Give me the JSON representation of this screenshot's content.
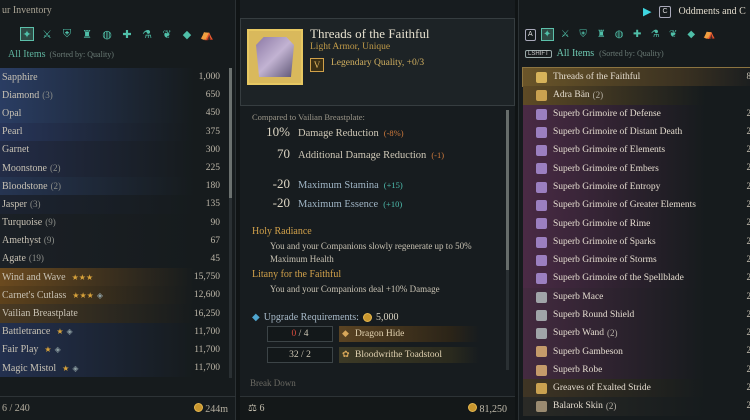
{
  "left": {
    "title": "ur Inventory",
    "all_items": "All Items",
    "sort": "(Sorted by: Quality)",
    "footer_count": "6 / 240",
    "footer_dist": "244m",
    "items": [
      {
        "name": "Sapphire",
        "count": "",
        "value": "1,000",
        "color": "#2a3d63"
      },
      {
        "name": "Diamond",
        "count": "(3)",
        "value": "650",
        "color": "#2a3d63"
      },
      {
        "name": "Opal",
        "count": "",
        "value": "450",
        "color": "#2a3d63"
      },
      {
        "name": "Pearl",
        "count": "",
        "value": "375",
        "color": "#27355a"
      },
      {
        "name": "Garnet",
        "count": "",
        "value": "300",
        "color": "#232c47"
      },
      {
        "name": "Moonstone",
        "count": "(2)",
        "value": "225",
        "color": "#232c47"
      },
      {
        "name": "Bloodstone",
        "count": "(2)",
        "value": "180",
        "color": "#263552"
      },
      {
        "name": "Jasper",
        "count": "(3)",
        "value": "135",
        "color": "#1c2331"
      },
      {
        "name": "Turquoise",
        "count": "(9)",
        "value": "90",
        "color": "#1b2026"
      },
      {
        "name": "Amethyst",
        "count": "(9)",
        "value": "67",
        "color": "#1b2026"
      },
      {
        "name": "Agate",
        "count": "(19)",
        "value": "45",
        "color": "#1b2026"
      },
      {
        "name": "Wind and Wave",
        "count": "",
        "stars": "★★★",
        "value": "15,750",
        "color": "#6b4a1f"
      },
      {
        "name": "Carnet's Cutlass",
        "count": "",
        "stars": "★★★",
        "mark": "◈",
        "value": "12,600",
        "color": "#5e421c"
      },
      {
        "name": "Vailian Breastplate",
        "count": "",
        "value": "16,250",
        "color": "#4a3a23"
      },
      {
        "name": "Battletrance",
        "count": "",
        "stars": "★",
        "mark": "◈",
        "value": "11,700",
        "color": "#23304f"
      },
      {
        "name": "Fair Play",
        "count": "",
        "stars": "★",
        "mark": "◈",
        "value": "11,700",
        "color": "#23304f"
      },
      {
        "name": "Magic Mistol",
        "count": "",
        "stars": "★",
        "mark": "◈",
        "value": "11,700",
        "color": "#23304f"
      }
    ]
  },
  "middle": {
    "item_name": "Threads of the Faithful",
    "item_type": "Light Armor, Unique",
    "level": "V",
    "quality": "Legendary Quality, +0/3",
    "compare": "Compared to Vailian Breastplate:",
    "stats": [
      {
        "value": "10%",
        "label": "Damage Reduction",
        "delta": "(-8%)",
        "kind": "neg"
      },
      {
        "value": "70",
        "label": "Additional Damage Reduction",
        "delta": "(-1)",
        "kind": "neg"
      },
      {
        "value": "-20",
        "label": "Maximum Stamina",
        "delta": "(+15)",
        "kind": "pos"
      },
      {
        "value": "-20",
        "label": "Maximum Essence",
        "delta": "(+10)",
        "kind": "pos"
      }
    ],
    "sections": [
      {
        "title": "Holy Radiance",
        "text": "You and your Companions slowly regenerate up to 50% Maximum Health"
      },
      {
        "title": "Litany for the Faithful",
        "text": "You and your Companions deal +10% Damage"
      }
    ],
    "upgrade_label": "Upgrade Requirements:",
    "upgrade_gold": "5,000",
    "materials": [
      {
        "have": "0",
        "need": "4",
        "name": "Dragon Hide"
      },
      {
        "have": "32",
        "need": "2",
        "name": "Bloodwrithe Toadstool"
      }
    ],
    "faded": "Break Down",
    "footer_count": "6",
    "footer_gold": "81,250"
  },
  "right": {
    "title": "Oddments and C",
    "all_items": "All Items",
    "sort": "(Sorted by: Quality)",
    "lshift": "LSHIFT",
    "items": [
      {
        "name": "Threads of the Faithful",
        "count": "",
        "right": "8",
        "icon": "#d7b35a",
        "sel": true
      },
      {
        "name": "Adra Bän",
        "count": "(2)",
        "right": "",
        "icon": "#c9a150",
        "bg": "#5e4a25"
      },
      {
        "name": "Superb Grimoire of Defense",
        "count": "",
        "right": "2",
        "icon": "#9b7fc0",
        "bg": "#4a2a45"
      },
      {
        "name": "Superb Grimoire of Distant Death",
        "count": "",
        "right": "2",
        "icon": "#9b7fc0",
        "bg": "#4a2a45"
      },
      {
        "name": "Superb Grimoire of Elements",
        "count": "",
        "right": "2",
        "icon": "#9b7fc0",
        "bg": "#4a2a45"
      },
      {
        "name": "Superb Grimoire of Embers",
        "count": "",
        "right": "2",
        "icon": "#9b7fc0",
        "bg": "#4a2a45"
      },
      {
        "name": "Superb Grimoire of Entropy",
        "count": "",
        "right": "2",
        "icon": "#9b7fc0",
        "bg": "#4a2a45"
      },
      {
        "name": "Superb Grimoire of Greater Elements",
        "count": "",
        "right": "2",
        "icon": "#9b7fc0",
        "bg": "#4a2a45"
      },
      {
        "name": "Superb Grimoire of Rime",
        "count": "",
        "right": "2",
        "icon": "#9b7fc0",
        "bg": "#4a2a45"
      },
      {
        "name": "Superb Grimoire of Sparks",
        "count": "",
        "right": "2",
        "icon": "#9b7fc0",
        "bg": "#4a2a45"
      },
      {
        "name": "Superb Grimoire of Storms",
        "count": "",
        "right": "2",
        "icon": "#9b7fc0",
        "bg": "#4a2a45"
      },
      {
        "name": "Superb Grimoire of the Spellblade",
        "count": "",
        "right": "2",
        "icon": "#9b7fc0",
        "bg": "#4a2a45"
      },
      {
        "name": "Superb Mace",
        "count": "",
        "right": "2",
        "icon": "#a0a4a8",
        "bg": "#442a40"
      },
      {
        "name": "Superb Round Shield",
        "count": "",
        "right": "2",
        "icon": "#a0a4a8",
        "bg": "#442a40"
      },
      {
        "name": "Superb Wand",
        "count": "(2)",
        "right": "2",
        "icon": "#a0a4a8",
        "bg": "#442a40"
      },
      {
        "name": "Superb Gambeson",
        "count": "",
        "right": "2",
        "icon": "#c49a6a",
        "bg": "#442a40"
      },
      {
        "name": "Superb Robe",
        "count": "",
        "right": "2",
        "icon": "#c49a6a",
        "bg": "#442a40"
      },
      {
        "name": "Greaves of Exalted Stride",
        "count": "",
        "right": "2",
        "icon": "#c9a150",
        "bg": "#3f3524"
      },
      {
        "name": "Balarok Skin",
        "count": "(2)",
        "right": "2",
        "icon": "#9a8a70",
        "bg": "#2a2a26"
      }
    ]
  },
  "colors": {
    "accent": "#4fbfa8",
    "gold": "#d0a04a",
    "selected": "#6a5529"
  }
}
